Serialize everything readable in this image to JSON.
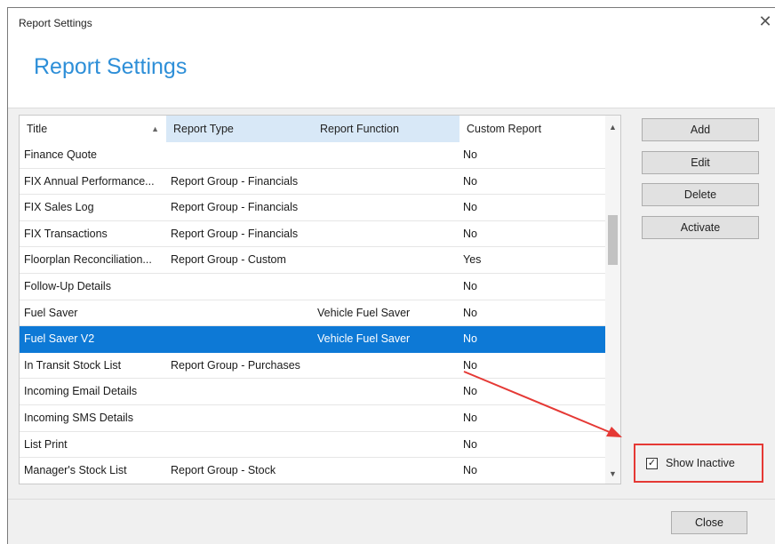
{
  "window": {
    "title": "Report Settings",
    "close_glyph": "✕"
  },
  "header": {
    "title": "Report Settings"
  },
  "grid": {
    "columns": [
      "Title",
      "Report Type",
      "Report Function",
      "Custom Report"
    ],
    "sort_indicator": "▲",
    "rows": [
      [
        "Finance Quote",
        "",
        "",
        "No"
      ],
      [
        "FIX Annual Performance...",
        "Report Group - Financials",
        "",
        "No"
      ],
      [
        "FIX Sales Log",
        "Report Group - Financials",
        "",
        "No"
      ],
      [
        "FIX Transactions",
        "Report Group - Financials",
        "",
        "No"
      ],
      [
        "Floorplan Reconciliation...",
        "Report Group - Custom",
        "",
        "Yes"
      ],
      [
        "Follow-Up Details",
        "",
        "",
        "No"
      ],
      [
        "Fuel Saver",
        "",
        "Vehicle Fuel Saver",
        "No"
      ],
      [
        "Fuel Saver V2",
        "",
        "Vehicle Fuel Saver",
        "No"
      ],
      [
        "In Transit Stock List",
        "Report Group - Purchases",
        "",
        "No"
      ],
      [
        "Incoming Email Details",
        "",
        "",
        "No"
      ],
      [
        "Incoming SMS Details",
        "",
        "",
        "No"
      ],
      [
        "List Print",
        "",
        "",
        "No"
      ],
      [
        "Manager's Stock List",
        "Report Group - Stock",
        "",
        "No"
      ]
    ],
    "selected_row": 7,
    "scroll_up_glyph": "▲",
    "scroll_down_glyph": "▼"
  },
  "buttons": {
    "add": "Add",
    "edit": "Edit",
    "delete": "Delete",
    "activate": "Activate",
    "close": "Close"
  },
  "show_inactive": {
    "label": "Show Inactive",
    "checked": true,
    "check_glyph": "✓"
  },
  "colors": {
    "accent": "#2e8fd8",
    "selection": "#0d79d6",
    "highlight_border": "#e53935"
  }
}
